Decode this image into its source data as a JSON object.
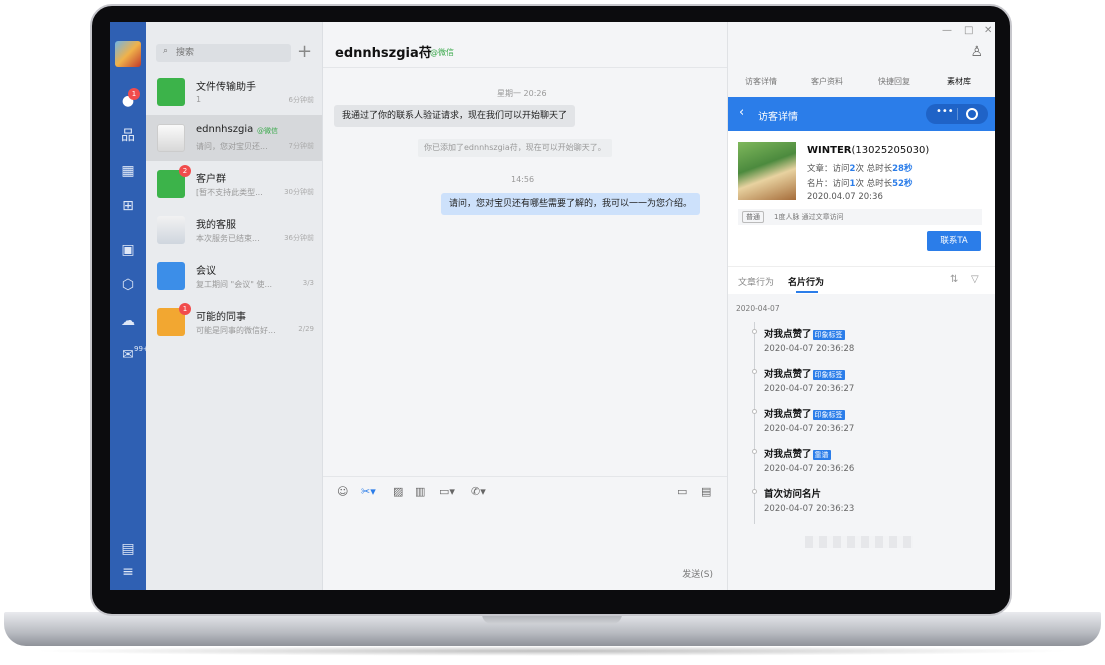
{
  "nav": {
    "chat_badge": "1",
    "mail_count": "99+"
  },
  "search": {
    "placeholder": "搜索"
  },
  "conversations": [
    {
      "name": "文件传输助手",
      "tag": "",
      "preview": "1",
      "time": "6分钟前",
      "badge": "",
      "color": "#3cb34a"
    },
    {
      "name": "ednnhszgia",
      "tag": "@微信",
      "preview": "请问，您对宝贝还...",
      "time": "7分钟前",
      "badge": "",
      "color": "#f0f0f0"
    },
    {
      "name": "客户群",
      "tag": "",
      "preview": "[暂不支持此类型...",
      "time": "30分钟前",
      "badge": "2",
      "color": "#3cb34a"
    },
    {
      "name": "我的客服",
      "tag": "",
      "preview": "本次服务已结束...",
      "time": "36分钟前",
      "badge": "",
      "color": "#eeeeee"
    },
    {
      "name": "会议",
      "tag": "",
      "preview": "复工期间 \"会议\" 使...",
      "time": "3/3",
      "badge": "",
      "color": "#3c8ee8"
    },
    {
      "name": "可能的同事",
      "tag": "",
      "preview": "可能是同事的微信好...",
      "time": "2/29",
      "badge": "1",
      "color": "#f2a731"
    }
  ],
  "chat": {
    "title": "ednnhszgia苻",
    "title_tag": "@微信",
    "time1": "星期一 20:26",
    "msg1": "我通过了你的联系人验证请求，现在我们可以开始聊天了",
    "notice": "你已添加了ednnhszgia苻，现在可以开始聊天了。",
    "time2": "14:56",
    "msg2": "请问，您对宝贝还有哪些需要了解的，我可以一一为您介绍。",
    "send_label": "发送(S)"
  },
  "right": {
    "tabs": [
      "访客详情",
      "客户资料",
      "快捷回复",
      "素材库"
    ],
    "active_tab": 3,
    "panel_title": "访客详情",
    "visitor": {
      "name": "WINTER",
      "phone": "(13025205030)",
      "article_prefix": "文章：访问",
      "article_visits": "2",
      "article_mid": "次 总时长",
      "article_duration": "28秒",
      "card_prefix": "名片：访问",
      "card_visits": "1",
      "card_mid": "次 总时长",
      "card_duration": "52秒",
      "date": "2020.04.07 20:36"
    },
    "tag_chip": "普通",
    "tag_text": "1度人脉  通过文章访问",
    "contact_button": "联系TA",
    "subtabs": [
      "文章行为",
      "名片行为"
    ],
    "timeline_date": "2020-04-07",
    "timeline": [
      {
        "title": "对我点赞了",
        "badge": "印象标签",
        "time": "2020-04-07 20:36:28"
      },
      {
        "title": "对我点赞了",
        "badge": "印象标签",
        "time": "2020-04-07 20:36:27"
      },
      {
        "title": "对我点赞了",
        "badge": "印象标签",
        "time": "2020-04-07 20:36:27"
      },
      {
        "title": "对我点赞了",
        "badge": "靠谱",
        "time": "2020-04-07 20:36:26"
      },
      {
        "title": "首次访问名片",
        "badge": "",
        "time": "2020-04-07 20:36:23"
      }
    ]
  }
}
